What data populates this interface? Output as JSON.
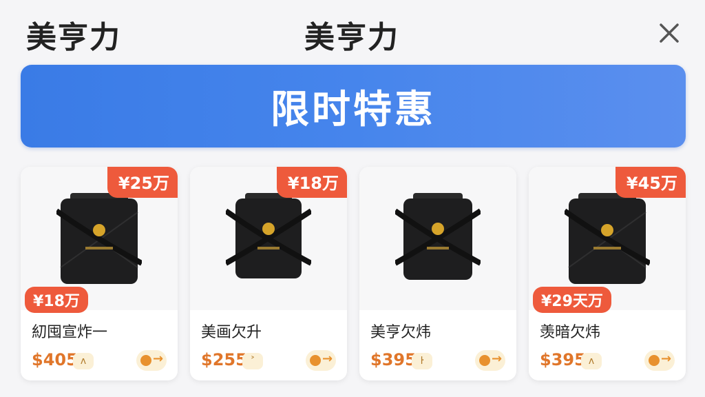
{
  "header": {
    "brand_left": "美亨力",
    "brand_center": "美亨力",
    "close_icon": "close-icon"
  },
  "banner": {
    "title": "限时特惠"
  },
  "products": [
    {
      "badge_top": "¥25万",
      "badge_bottom": "¥18万",
      "name": "糿囤宣炸一",
      "price": "$405",
      "mini_tag": "ʌ"
    },
    {
      "badge_top": "¥18万",
      "badge_bottom": "",
      "name": "美画欠升",
      "price": "$255",
      "mini_tag": "˃"
    },
    {
      "badge_top": "",
      "badge_bottom": "",
      "name": "美亨欠炜",
      "price": "$395",
      "mini_tag": "ŀ"
    },
    {
      "badge_top": "¥45万",
      "badge_bottom": "¥29天万",
      "name": "羡暗欠炜",
      "price": "$395",
      "mini_tag": "ʌ"
    }
  ],
  "colors": {
    "accent": "#ee5a3c",
    "banner": "#3a7be6",
    "price": "#e0762a"
  }
}
